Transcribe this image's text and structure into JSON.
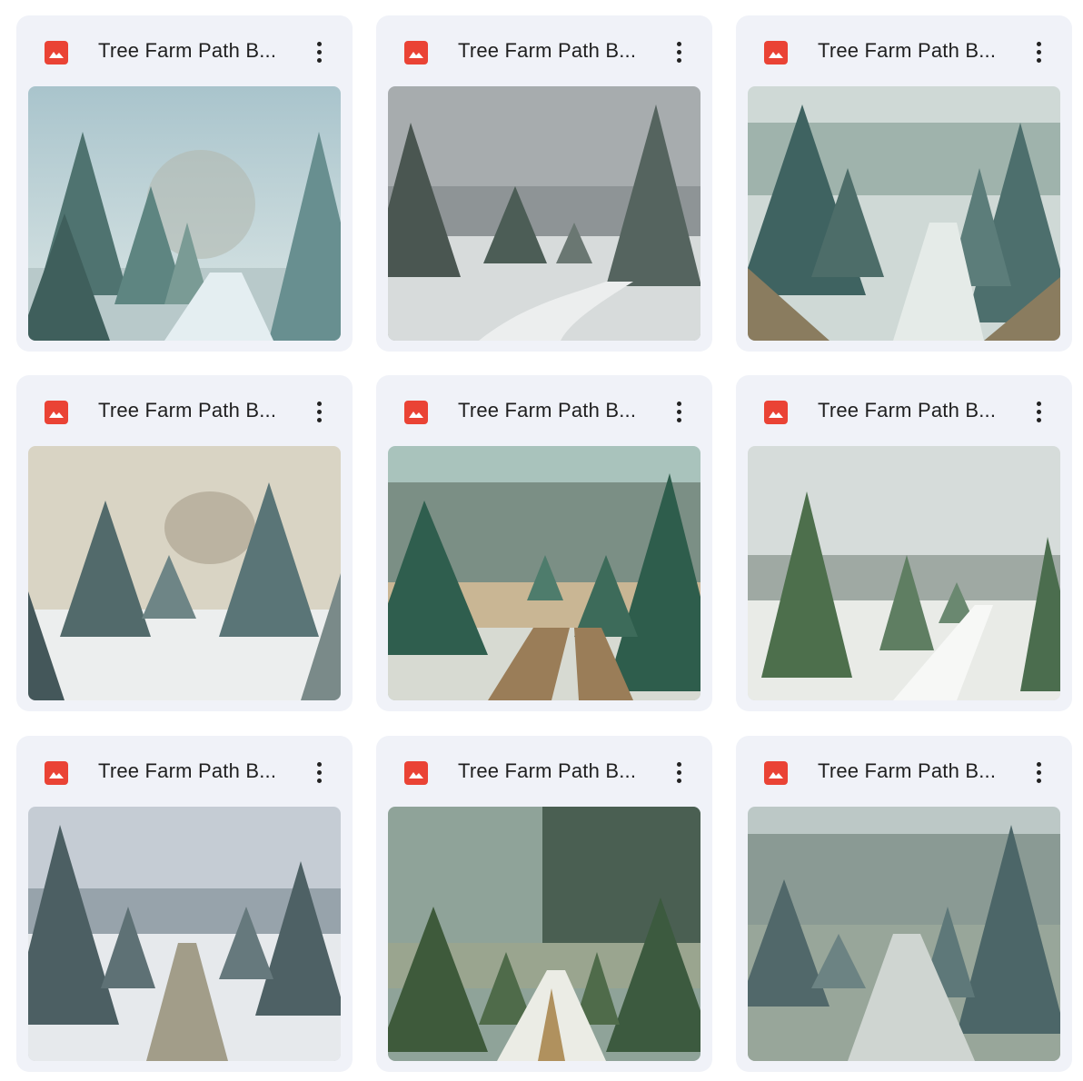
{
  "files": [
    {
      "name": "Tree Farm Path B...",
      "icon": "image-file-icon",
      "menu_icon": "more-vert-icon",
      "thumb": "snowy path between blue spruce trees"
    },
    {
      "name": "Tree Farm Path B...",
      "icon": "image-file-icon",
      "menu_icon": "more-vert-icon",
      "thumb": "grey sky over snowy field with spruce trees"
    },
    {
      "name": "Tree Farm Path B...",
      "icon": "image-file-icon",
      "menu_icon": "more-vert-icon",
      "thumb": "rows of spruce trees with falling snow"
    },
    {
      "name": "Tree Farm Path B...",
      "icon": "image-file-icon",
      "menu_icon": "more-vert-icon",
      "thumb": "frosted spruce trees under pale sky"
    },
    {
      "name": "Tree Farm Path B...",
      "icon": "image-file-icon",
      "menu_icon": "more-vert-icon",
      "thumb": "dirt path through green trees with snow"
    },
    {
      "name": "Tree Farm Path B...",
      "icon": "image-file-icon",
      "menu_icon": "more-vert-icon",
      "thumb": "tall tree beside snowy path"
    },
    {
      "name": "Tree Farm Path B...",
      "icon": "image-file-icon",
      "menu_icon": "more-vert-icon",
      "thumb": "snow covered path between tree rows"
    },
    {
      "name": "Tree Farm Path B...",
      "icon": "image-file-icon",
      "menu_icon": "more-vert-icon",
      "thumb": "misty green forest path with snowfall"
    },
    {
      "name": "Tree Farm Path B...",
      "icon": "image-file-icon",
      "menu_icon": "more-vert-icon",
      "thumb": "frosty grass path between spruce rows"
    }
  ],
  "colors": {
    "card_bg": "#f0f2f8",
    "icon_red": "#ea4335",
    "text": "#1f1f1f"
  }
}
